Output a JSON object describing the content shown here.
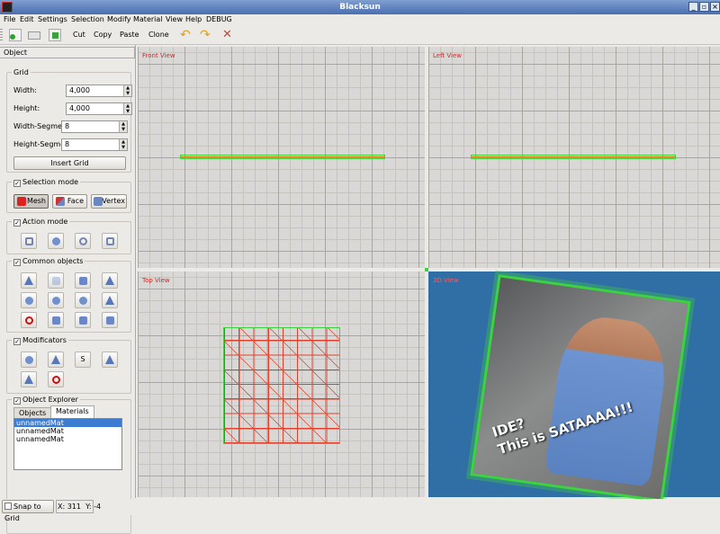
{
  "window": {
    "title": "Blacksun"
  },
  "menu": [
    "File",
    "Edit",
    "Settings",
    "Selection",
    "Modify",
    "Material",
    "View",
    "Help",
    "DEBUG"
  ],
  "toolbar": {
    "cut": "Cut",
    "copy": "Copy",
    "paste": "Paste",
    "clone": "Clone"
  },
  "panel": {
    "tab": "Object",
    "grid": {
      "title": "Grid",
      "width_label": "Width:",
      "width": "4,000",
      "height_label": "Height:",
      "height": "4,000",
      "wseg_label": "Width-Segmer",
      "wseg": "8",
      "hseg_label": "Height-Segme",
      "hseg": "8",
      "insert": "Insert Grid"
    },
    "selection": {
      "title": "Selection mode",
      "checked": true,
      "mesh": "Mesh",
      "face": "Face",
      "vertex": "Vertex"
    },
    "action": {
      "title": "Action mode",
      "checked": true
    },
    "common": {
      "title": "Common objects",
      "checked": true
    },
    "modificators": {
      "title": "Modificators",
      "checked": true,
      "s_label": "S"
    },
    "explorer": {
      "title": "Object Explorer",
      "checked": true,
      "tab_objects": "Objects",
      "tab_materials": "Materials",
      "materials": [
        "unnamedMat",
        "unnamedMat",
        "unnamedMat"
      ]
    }
  },
  "views": {
    "front": "Front View",
    "left": "Left View",
    "top": "Top View",
    "v3d": "3D View"
  },
  "image_caption": "IDE?\nThis is SATAAAA!!!",
  "status": {
    "snap": "Snap to Grid",
    "coords": "X: 311  Y: -4"
  },
  "colors": {
    "title_bar": "#4a6eb0",
    "viewport_bg": "#d9d8d6",
    "selection_green": "#3ed23e",
    "mesh_red": "#e0402a",
    "view3d_bg": "#2f6fa5"
  }
}
